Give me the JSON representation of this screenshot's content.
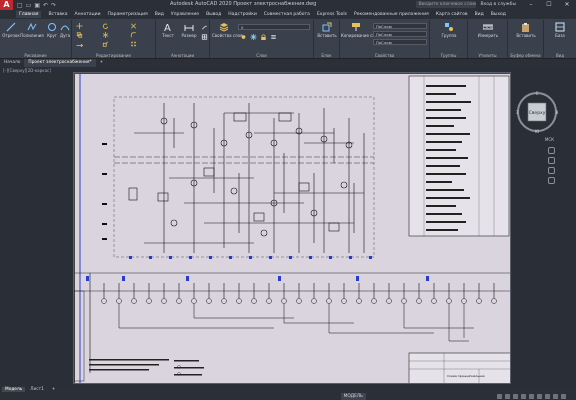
{
  "app": {
    "logo_letter": "A",
    "title": "Autodesk AutoCAD 2020   Проект электроснабжения.dwg",
    "search_placeholder": "Введите ключевое слово/фразу",
    "signin": "Вход в службы",
    "win_min": "–",
    "win_max": "☐",
    "win_close": "✕"
  },
  "menu_tabs": [
    "Главная",
    "Вставка",
    "Аннотации",
    "Параметризация",
    "Вид",
    "Управление",
    "Вывод",
    "Надстройки",
    "Совместная работа",
    "Express Tools",
    "Рекомендованные приложения",
    "Карта сайтов",
    "Вид",
    "Выход"
  ],
  "ribbon": {
    "groups": [
      {
        "label": "Рисование"
      },
      {
        "label": "Редактирование"
      },
      {
        "label": "Аннотации"
      },
      {
        "label": "Слои"
      },
      {
        "label": "Блок"
      },
      {
        "label": "Свойства"
      },
      {
        "label": "Группы"
      },
      {
        "label": "Утилиты"
      },
      {
        "label": "Буфер обмена"
      },
      {
        "label": "Вид"
      }
    ],
    "tools": {
      "line": "Отрезок",
      "polyline": "Полилиния",
      "circle": "Круг",
      "arc": "Дуга",
      "text": "Текст",
      "dimension": "Размер",
      "layer_props": "Свойства слоя",
      "insert": "Вставить",
      "match_props": "Копирование свойств",
      "group": "Группа",
      "measure": "Измерить",
      "paste": "Вставить",
      "base": "База"
    },
    "combos": {
      "layer": "0",
      "color": "ПоСлою",
      "linetype": "ПоСлою",
      "lineweight": "ПоСлою"
    }
  },
  "file_tabs": [
    "Начало",
    "Проект электроснабжения*"
  ],
  "viewport_label": "[–][Сверху][2D-каркас]",
  "viewcube": {
    "top": "Сверху",
    "north": "С",
    "south": "Ю",
    "east": "В",
    "west": "З",
    "wcs": "МСК"
  },
  "layout_tabs": [
    "Модель",
    "Лист1"
  ],
  "status": {
    "mode": "МОДЕЛЬ"
  },
  "drawing": {
    "stamp_title": "Схема принципиальная"
  }
}
